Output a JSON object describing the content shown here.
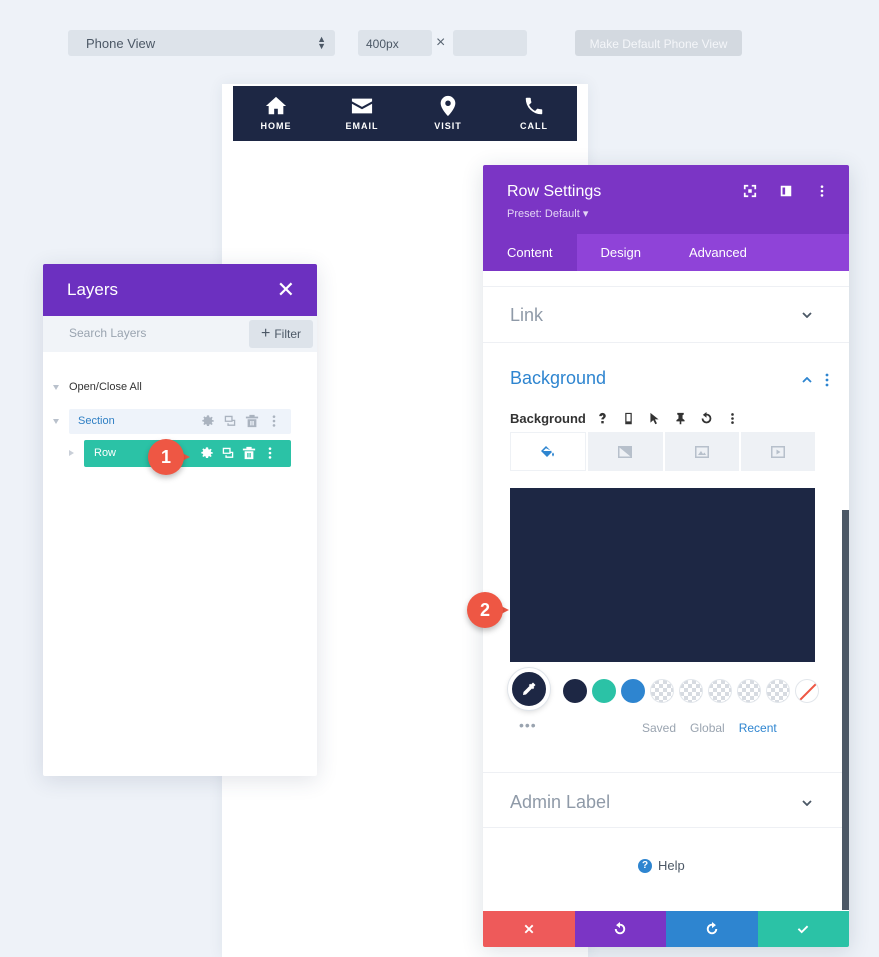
{
  "topbar": {
    "view_select": "Phone View",
    "width_value": "400px",
    "times_symbol": "×",
    "height_value": "",
    "make_default_label": "Make Default Phone View"
  },
  "phone_nav": {
    "items": [
      {
        "label": "HOME",
        "icon": "home-icon"
      },
      {
        "label": "EMAIL",
        "icon": "envelope-icon"
      },
      {
        "label": "VISIT",
        "icon": "map-pin-icon"
      },
      {
        "label": "CALL",
        "icon": "phone-icon"
      }
    ],
    "bg_color": "#1d2744"
  },
  "layers": {
    "title": "Layers",
    "search_placeholder": "Search Layers",
    "filter_label": "Filter",
    "open_close_label": "Open/Close All",
    "section_label": "Section",
    "row_label": "Row",
    "header_color": "#6c30c0",
    "row_color": "#2bc2a6"
  },
  "annotations": {
    "badge1": "1",
    "badge2": "2",
    "color": "#ee5744"
  },
  "row_settings": {
    "title": "Row Settings",
    "preset": "Preset: Default ▾",
    "tabs": [
      {
        "label": "Content",
        "active": true
      },
      {
        "label": "Design",
        "active": false
      },
      {
        "label": "Advanced",
        "active": false
      }
    ],
    "link_label": "Link",
    "background_title": "Background",
    "background_field_label": "Background",
    "background_color": "#1d2744",
    "swatches": [
      "#1d2744",
      "#2bc2a6",
      "#2e85d0"
    ],
    "palette_tabs": [
      {
        "label": "Saved",
        "active": false
      },
      {
        "label": "Global",
        "active": false
      },
      {
        "label": "Recent",
        "active": true
      }
    ],
    "admin_label": "Admin Label",
    "help_label": "Help",
    "footer_colors": {
      "cancel": "#ee5a5a",
      "undo": "#7b35c5",
      "redo": "#2e85d0",
      "save": "#2bc2a6"
    }
  }
}
